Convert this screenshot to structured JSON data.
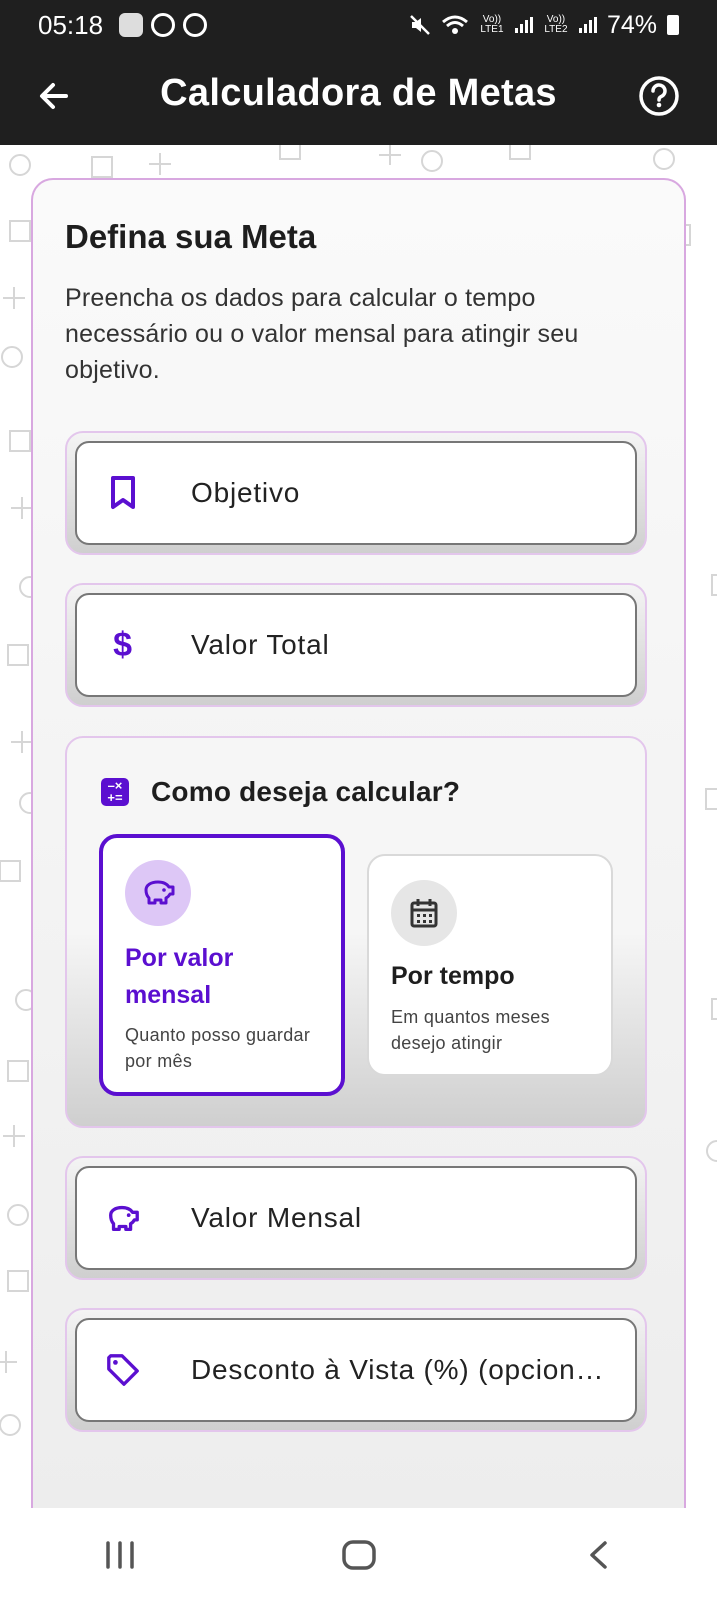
{
  "status_bar": {
    "time": "05:18",
    "battery_percent": "74%",
    "net1": "Vo)) LTE1",
    "net2": "Vo)) LTE2",
    "icons": [
      "app-icon",
      "spotify-icon",
      "sync-icon",
      "mute-icon",
      "wifi-icon",
      "signal-icon",
      "battery-icon"
    ]
  },
  "app_bar": {
    "title": "Calculadora de Metas",
    "back_icon": "arrow-left-icon",
    "help_icon": "help-circle-icon"
  },
  "card": {
    "title": "Defina sua Meta",
    "description": "Preencha os dados para calcular o tempo necessário ou o valor mensal para atingir seu objetivo."
  },
  "fields": {
    "objetivo": {
      "label": "Objetivo",
      "icon": "bookmark-icon"
    },
    "valor_total": {
      "label": "Valor Total",
      "icon": "dollar-icon"
    },
    "valor_mensal": {
      "label": "Valor Mensal",
      "icon": "piggy-bank-icon"
    },
    "desconto": {
      "label": "Desconto à Vista (%) (opcion…",
      "icon": "tag-icon"
    }
  },
  "calc_mode": {
    "title": "Como deseja calcular?",
    "icon": "calculator-icon",
    "options": [
      {
        "title": "Por valor mensal",
        "desc": "Quanto posso guardar por mês",
        "icon": "piggy-bank-icon",
        "selected": true
      },
      {
        "title": "Por tempo",
        "desc": "Em quantos meses desejo atingir",
        "icon": "calendar-icon",
        "selected": false
      }
    ]
  },
  "colors": {
    "accent": "#5b0fd0",
    "accent_light": "#ddc7f6",
    "card_border": "#d8a8e0",
    "bar_bg": "#1f1f1f"
  },
  "nav_bar": {
    "icons": [
      "recent-apps-icon",
      "home-icon",
      "back-icon"
    ]
  }
}
